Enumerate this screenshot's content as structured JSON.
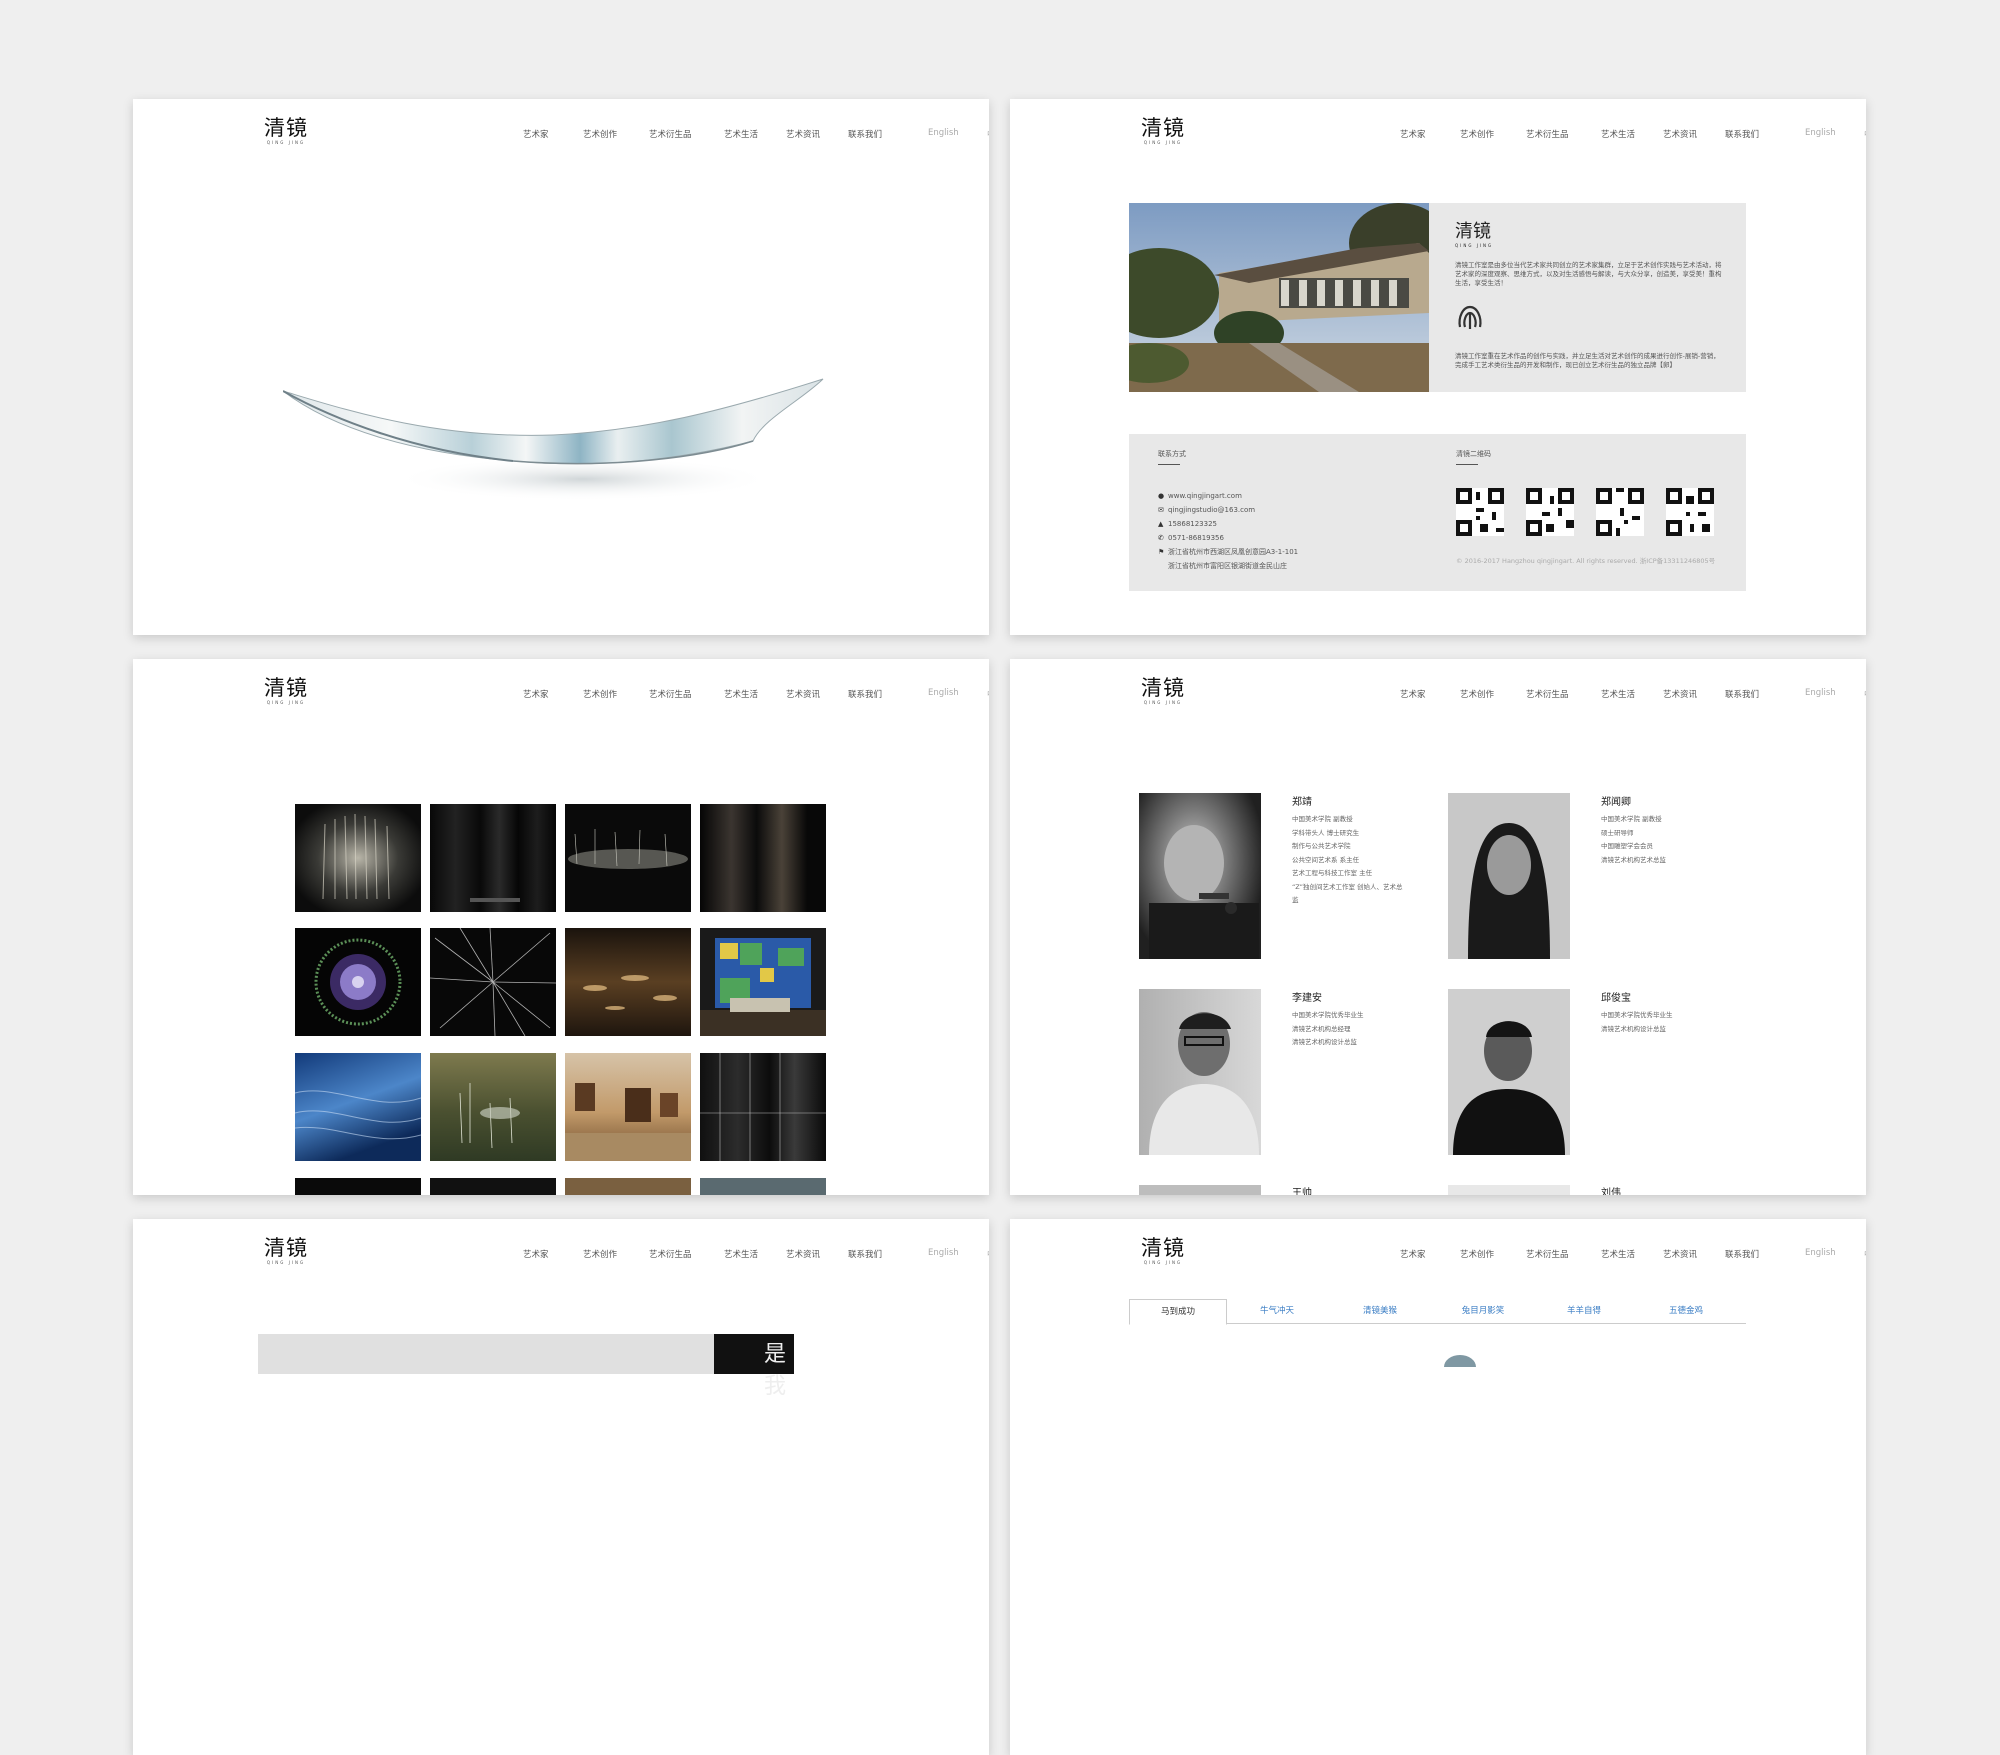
{
  "brand": {
    "name_cn": "清镜",
    "name_en": "QING JING"
  },
  "nav": {
    "items": [
      "艺术家",
      "艺术创作",
      "艺术衍生品",
      "艺术生活",
      "艺术资讯",
      "联系我们"
    ],
    "lang_en": "English",
    "lang_cn": "中文"
  },
  "about": {
    "intro": "清镜工作室是由多位当代艺术家共同创立的艺术家集群，立足于艺术创作实践与艺术活动，将艺术家的深度观察、思维方式，以及对生活感悟与解读，与大众分享，创造美，享受美！重构生活，享受生活！",
    "intro2": "清镜工作室重在艺术作品的创作与实践，并立足生活对艺术创作的成果进行创作-展销-营销，完成手工艺术类衍生品的开发和制作，现已创立艺术衍生品的独立品牌【卵】",
    "contact_title": "联系方式",
    "qr_title": "清镜二维码",
    "website": "www.qingjingart.com",
    "email": "qingjingstudio@163.com",
    "mobile": "15868123325",
    "phone": "0571-86819356",
    "address1": "浙江省杭州市西湖区凤凰创意园A3-1-101",
    "address2": "浙江省杭州市富阳区银湖街道金民山庄",
    "copyright": "© 2016-2017 Hangzhou qingjingart. All rights reserved. 浙ICP备13311246805号"
  },
  "artists": [
    {
      "name": "郑靖",
      "bio": [
        "中国美术学院 副教授",
        "学科带头人 博士研究生",
        "制作与公共艺术学院",
        "公共空间艺术系 系主任",
        "艺术工程与科技工作室 主任",
        "“Z”独创间艺术工作室 创始人、艺术总",
        "监"
      ]
    },
    {
      "name": "郑闻卿",
      "bio": [
        "中国美术学院 副教授",
        "硕士研导师",
        "中国雕塑学会会员",
        "清镜艺术机构艺术总监"
      ]
    },
    {
      "name": "李建安",
      "bio": [
        "中国美术学院优秀毕业生",
        "清镜艺术机构总经理",
        "清镜艺术机构设计总监"
      ]
    },
    {
      "name": "邱俊宝",
      "bio": [
        "中国美术学院优秀毕业生",
        "清镜艺术机构设计总监"
      ]
    },
    {
      "name": "王帅",
      "bio": []
    },
    {
      "name": "刘伟",
      "bio": []
    }
  ],
  "card5": {
    "title_fragment": "是我"
  },
  "tabs": [
    "马到成功",
    "牛气冲天",
    "清镜美猴",
    "兔目月影笑",
    "羊羊自得",
    "五德金鸡"
  ],
  "colors": {
    "background": "#efefef",
    "panel": "#e8e8e8",
    "link": "#3a7dc4"
  }
}
